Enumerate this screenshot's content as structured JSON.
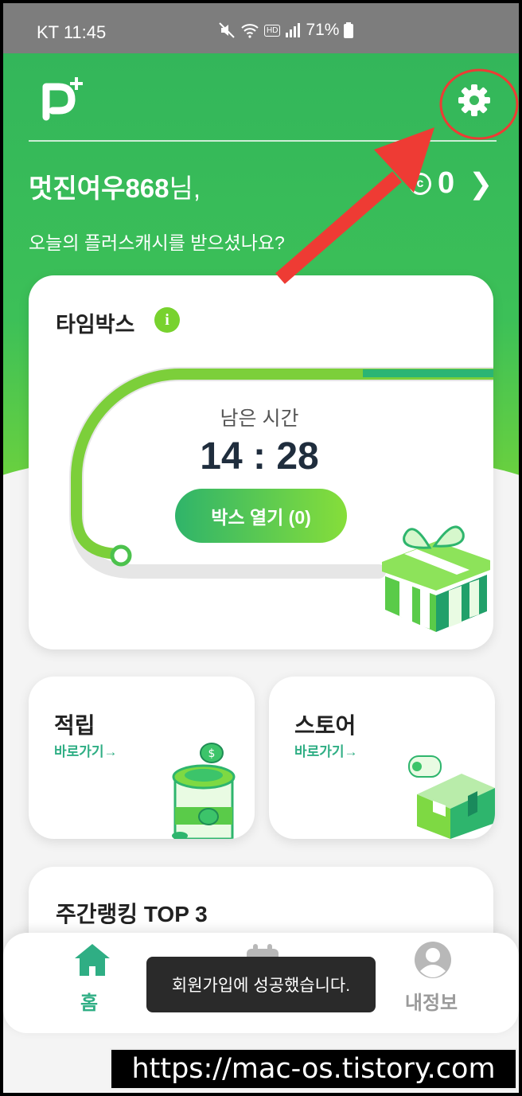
{
  "status_bar": {
    "carrier_time": "KT 11:45",
    "hd": "HD",
    "battery": "71%"
  },
  "header": {
    "logo_text": "P",
    "logo_plus": "+",
    "greeting_name": "멋진여우868",
    "greeting_suffix": "님,",
    "points": "0",
    "points_coin": "c",
    "subtitle": "오늘의 플러스캐시를 받으셨나요?"
  },
  "timebox": {
    "title": "타임박스",
    "info_icon": "i",
    "remaining_label": "남은 시간",
    "remaining_time": "14 : 28",
    "open_button": "박스 열기 (0)",
    "progress_fraction": 0.9
  },
  "shortcuts": {
    "save": {
      "title": "적립",
      "link": "바로가기→"
    },
    "store": {
      "title": "스토어",
      "link": "바로가기→"
    }
  },
  "ranking": {
    "title": "주간랭킹 TOP 3"
  },
  "bottom_nav": {
    "home": "홈",
    "my": "내정보"
  },
  "toast": "회원가입에 성공했습니다.",
  "watermark": "https://mac-os.tistory.com",
  "colors": {
    "brand_green": "#33b65a",
    "accent_lime": "#78d22e",
    "link_teal": "#2fae84",
    "annotation_red": "#ee3b34"
  },
  "icons": [
    "settings-gear-icon",
    "coin-icon",
    "chevron-right-icon",
    "info-icon",
    "gift-box-icon",
    "coin-jar-icon",
    "parcel-box-icon",
    "home-icon",
    "calendar-icon",
    "profile-icon",
    "mute-icon",
    "wifi-icon",
    "signal-icon",
    "battery-icon"
  ]
}
